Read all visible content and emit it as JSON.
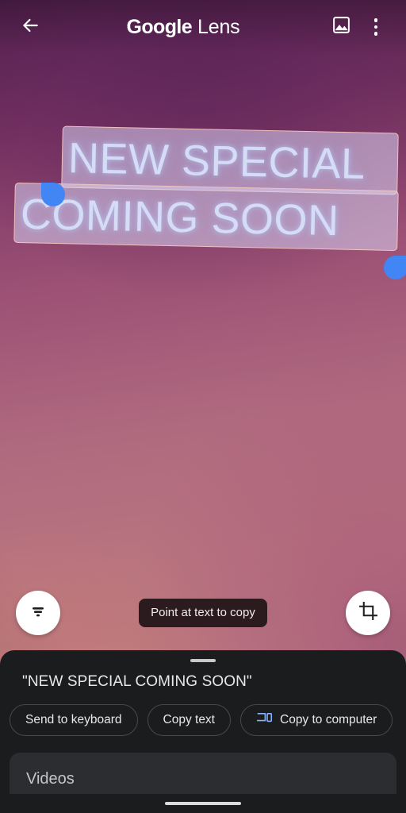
{
  "app": {
    "brand_primary": "Google",
    "brand_secondary": "Lens",
    "accent_blue": "#4285f4",
    "sheet_background": "#1b1c1e"
  },
  "topbar": {
    "back_icon": "arrow-back-icon",
    "gallery_icon": "image-icon",
    "overflow_icon": "more-vert-icon"
  },
  "viewfinder": {
    "detected_lines": [
      {
        "text": "NEW SPECIAL"
      },
      {
        "text": "COMING SOON"
      }
    ],
    "selection_handles": {
      "start": "selection-handle-start",
      "end": "selection-handle-end"
    },
    "tooltip": "Point at text to copy",
    "filter_fab_icon": "text-filter-icon",
    "crop_fab_icon": "crop-icon"
  },
  "sheet": {
    "grabber": "drag-handle",
    "recognized_text": "\"NEW SPECIAL COMING SOON\"",
    "actions": [
      {
        "label": "Send to keyboard",
        "icon": null
      },
      {
        "label": "Copy text",
        "icon": null
      },
      {
        "label": "Copy to computer",
        "icon": "devices-icon"
      }
    ],
    "videos_section_title": "Videos"
  },
  "system": {
    "nav_pill": "home-gesture-pill"
  }
}
